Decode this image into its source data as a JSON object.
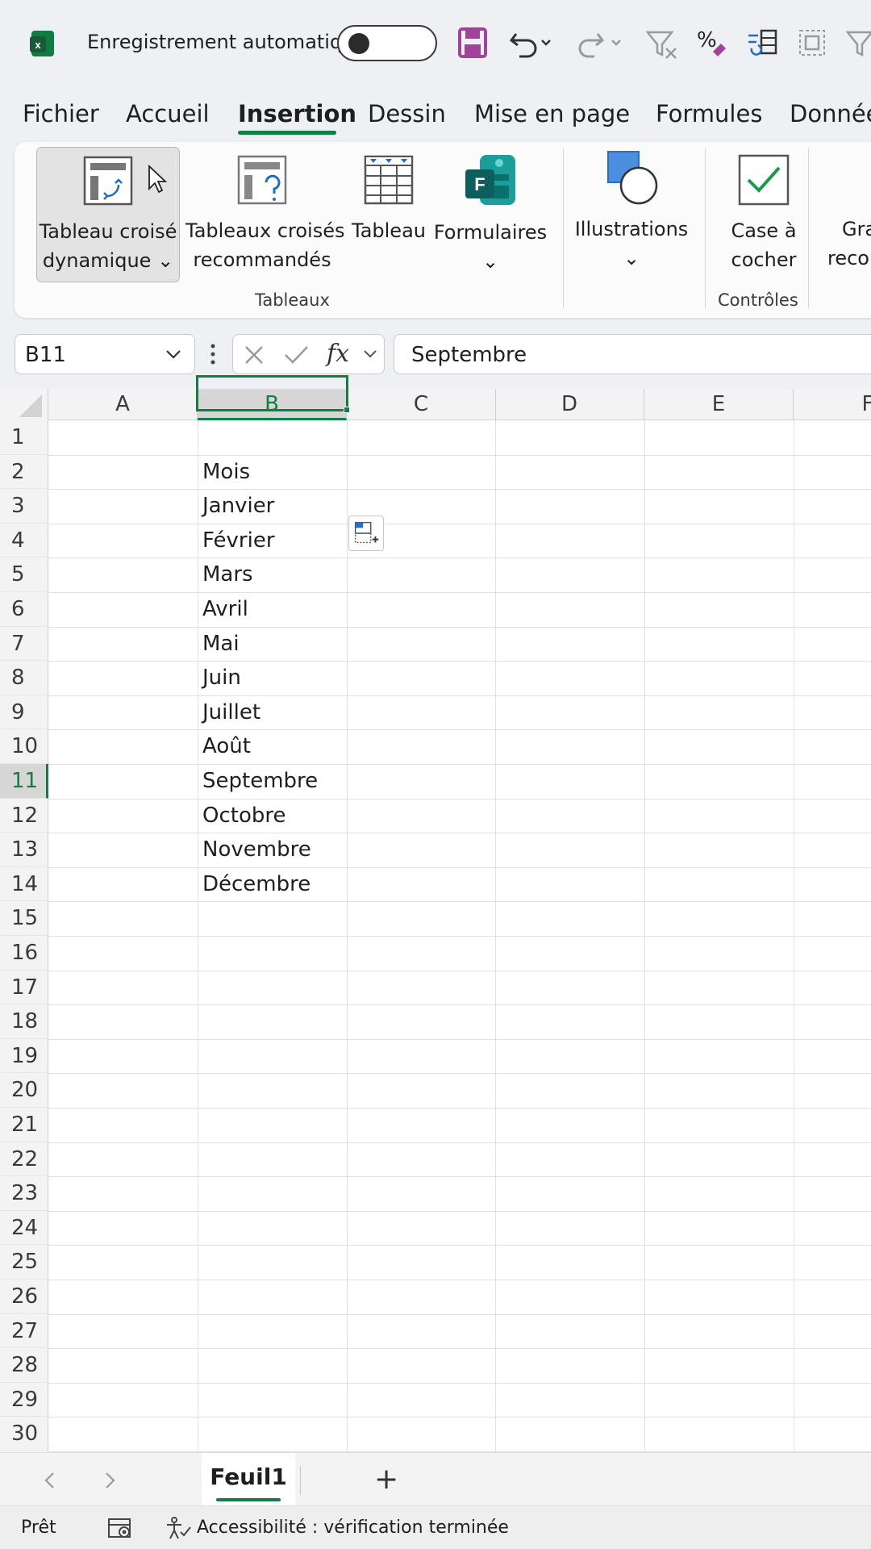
{
  "titlebar": {
    "autosave_label": "Enregistrement automatique",
    "autosave_state": "off",
    "icons": [
      "excel-logo",
      "save-icon",
      "undo-icon",
      "redo-icon",
      "clear-filter-icon",
      "percent-format-icon",
      "data-refresh-icon",
      "select-objects-icon",
      "filter-icon"
    ]
  },
  "tabs": [
    {
      "label": "Fichier"
    },
    {
      "label": "Accueil"
    },
    {
      "label": "Insertion",
      "active": true
    },
    {
      "label": "Dessin"
    },
    {
      "label": "Mise en page"
    },
    {
      "label": "Formules"
    },
    {
      "label": "Donnée"
    }
  ],
  "ribbon": {
    "pivot_table": {
      "line1": "Tableau croisé",
      "line2": "dynamique",
      "chevron": "⌄"
    },
    "recommended_pivot": {
      "line1": "Tableaux croisés",
      "line2": "recommandés"
    },
    "table": {
      "label": "Tableau"
    },
    "forms": {
      "label": "Formulaires",
      "chevron": "⌄"
    },
    "illustrations": {
      "label": "Illustrations",
      "chevron": "⌄"
    },
    "checkbox": {
      "line1": "Case à",
      "line2": "cocher"
    },
    "recommended_charts": {
      "line1": "Gra",
      "line2": "reco"
    },
    "groups": {
      "tables": "Tableaux",
      "controls": "Contrôles"
    }
  },
  "formula_bar": {
    "name_box": "B11",
    "formula_value": "Septembre",
    "fx": "fx"
  },
  "grid": {
    "columns": [
      "A",
      "B",
      "C",
      "D",
      "E",
      "F"
    ],
    "selected_column": "B",
    "selected_row": 11,
    "rows": [
      "1",
      "2",
      "3",
      "4",
      "5",
      "6",
      "7",
      "8",
      "9",
      "10",
      "11",
      "12",
      "13",
      "14",
      "15",
      "16",
      "17",
      "18",
      "19",
      "20",
      "21",
      "22",
      "23",
      "24",
      "25",
      "26",
      "27",
      "28",
      "29",
      "30"
    ],
    "column_b_values": [
      "",
      "Mois",
      "Janvier",
      "Février",
      "Mars",
      "Avril",
      "Mai",
      "Juin",
      "Juillet",
      "Août",
      "Septembre",
      "Octobre",
      "Novembre",
      "Décembre"
    ]
  },
  "sheets": {
    "tabs": [
      "Feuil1"
    ],
    "active": "Feuil1",
    "add_label": "+"
  },
  "status": {
    "ready": "Prêt",
    "accessibility": "Accessibilité : vérification terminée"
  },
  "colors": {
    "accent_green": "#117e43",
    "excel_green": "#107c41",
    "save_purple": "#a2439a"
  }
}
